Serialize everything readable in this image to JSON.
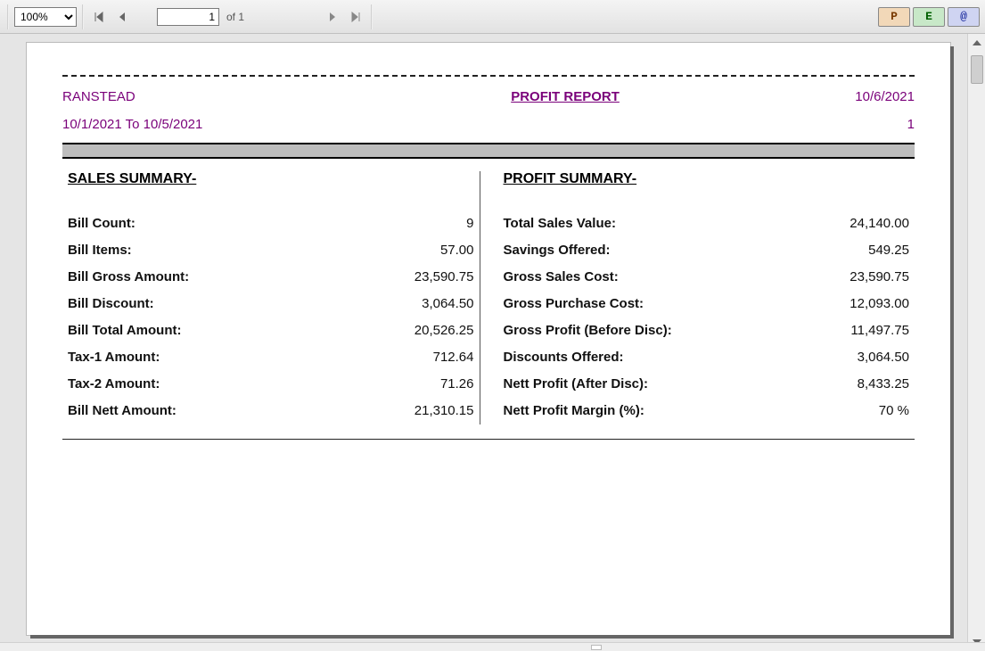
{
  "toolbar": {
    "zoom": "100%",
    "page_current": "1",
    "page_of": "of 1",
    "btn_p": "P",
    "btn_e": "E",
    "btn_at": "@"
  },
  "report": {
    "company": "RANSTEAD",
    "title": "PROFIT REPORT",
    "date": "10/6/2021",
    "range": "10/1/2021 To 10/5/2021",
    "page_no": "1"
  },
  "sales": {
    "heading": "SALES SUMMARY-",
    "rows": [
      {
        "label": "Bill Count:",
        "value": "9"
      },
      {
        "label": "Bill Items:",
        "value": "57.00"
      },
      {
        "label": "Bill Gross Amount:",
        "value": "23,590.75"
      },
      {
        "label": "Bill Discount:",
        "value": "3,064.50"
      },
      {
        "label": "Bill Total Amount:",
        "value": "20,526.25"
      },
      {
        "label": "Tax-1 Amount:",
        "value": "712.64"
      },
      {
        "label": "Tax-2 Amount:",
        "value": "71.26"
      },
      {
        "label": "Bill Nett Amount:",
        "value": "21,310.15"
      }
    ]
  },
  "profit": {
    "heading": "PROFIT SUMMARY-",
    "rows": [
      {
        "label": "Total Sales Value:",
        "value": "24,140.00"
      },
      {
        "label": "Savings Offered:",
        "value": "549.25"
      },
      {
        "label": "Gross Sales Cost:",
        "value": "23,590.75"
      },
      {
        "label": "Gross Purchase Cost:",
        "value": "12,093.00"
      },
      {
        "label": "Gross Profit (Before Disc):",
        "value": "11,497.75"
      },
      {
        "label": "Discounts Offered:",
        "value": "3,064.50"
      },
      {
        "label": "Nett Profit (After Disc):",
        "value": "8,433.25"
      },
      {
        "label": "Nett Profit Margin (%):",
        "value": "70 %"
      }
    ]
  }
}
